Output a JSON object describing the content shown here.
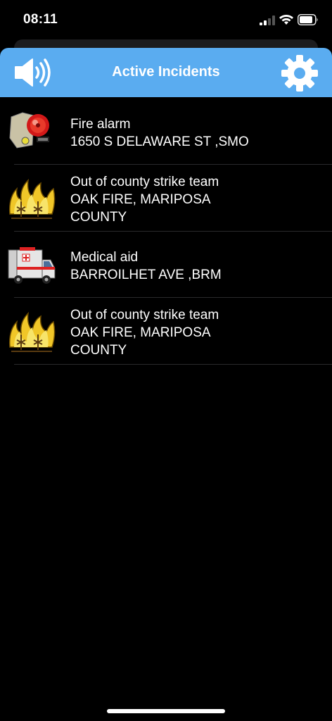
{
  "status_bar": {
    "time": "08:11",
    "signal_icon": "cellular-signal-icon",
    "wifi_icon": "wifi-icon",
    "battery_icon": "battery-icon"
  },
  "header": {
    "title": "Active Incidents",
    "speaker_icon": "speaker-icon",
    "settings_icon": "gear-icon",
    "background_color": "#5aacf0"
  },
  "incidents": [
    {
      "type": "Fire alarm",
      "location": "1650 S DELAWARE ST ,SMO",
      "location_line2": "",
      "icon": "fire-alarm-bell-icon"
    },
    {
      "type": "Out of county strike team",
      "location": "OAK FIRE, MARIPOSA",
      "location_line2": "COUNTY",
      "icon": "wildfire-icon"
    },
    {
      "type": "Medical aid",
      "location": "BARROILHET AVE ,BRM",
      "location_line2": "",
      "icon": "ambulance-icon"
    },
    {
      "type": "Out of county strike team",
      "location": "OAK FIRE, MARIPOSA",
      "location_line2": "COUNTY",
      "icon": "wildfire-icon"
    }
  ]
}
